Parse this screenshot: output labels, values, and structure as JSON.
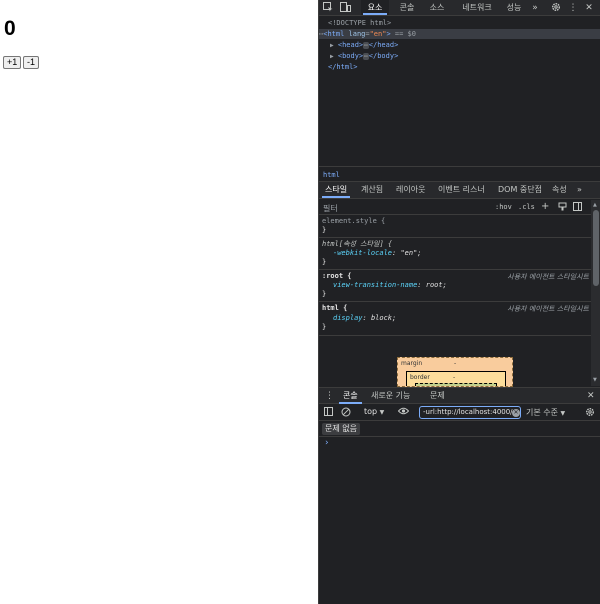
{
  "page": {
    "counter_value": "0",
    "increment_label": "+1",
    "decrement_label": "-1"
  },
  "devtools": {
    "top_tabs": [
      "요소",
      "콘솔",
      "소스",
      "네트워크",
      "성능"
    ],
    "active_top_tab": "요소",
    "more_tabs_icon": "chevrons-right-icon",
    "dom": {
      "doctype": "<!DOCTYPE html>",
      "html_open_tag": "html",
      "html_attr_name": "lang",
      "html_attr_value": "\"en\"",
      "html_selected_marker": "== $0",
      "head_tag": "head",
      "body_tag": "body",
      "html_close": "</html>"
    },
    "breadcrumb": "html",
    "styles_tabs": [
      "스타일",
      "계산됨",
      "레이아웃",
      "이벤트 리스너",
      "DOM 중단점",
      "속성"
    ],
    "active_styles_tab": "스타일",
    "filter_placeholder": "필터",
    "hov_label": ":hov",
    "cls_label": ".cls",
    "rules": [
      {
        "selector": "element.style {",
        "origin": "",
        "declarations": [],
        "close": "}"
      },
      {
        "selector": "html[속성 스타일] {",
        "origin": "",
        "declarations": [
          {
            "prop": "-webkit-locale",
            "value": "\"en\";"
          }
        ],
        "close": "}"
      },
      {
        "selector": ":root {",
        "origin": "사용자 에이전트 스타일시트",
        "declarations": [
          {
            "prop": "view-transition-name",
            "value": "root;"
          }
        ],
        "close": "}"
      },
      {
        "selector": "html {",
        "origin": "사용자 에이전트 스타일시트",
        "declarations": [
          {
            "prop": "display",
            "value": "block;"
          }
        ],
        "close": "}"
      }
    ],
    "box_model": {
      "margin_label": "margin",
      "margin_value": "-",
      "border_label": "border",
      "border_value": "-"
    },
    "drawer_tabs": [
      "콘솔",
      "새로운 기능",
      "문제"
    ],
    "active_drawer_tab": "콘솔",
    "console": {
      "context": "top",
      "filter_value": "-url:http://localhost:4000/",
      "levels": "기본 수준",
      "issues": "문제 없음",
      "prompt": "›"
    },
    "colors": {
      "panel_bg": "#202124",
      "accent": "#7cacf8",
      "tag_color": "#7cacf8",
      "prop_color": "#5cd5fb"
    }
  }
}
